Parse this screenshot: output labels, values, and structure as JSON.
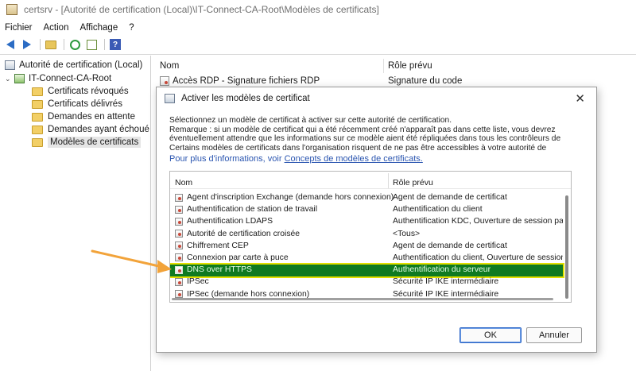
{
  "window": {
    "title": "certsrv - [Autorité de certification (Local)\\IT-Connect-CA-Root\\Modèles de certificats]"
  },
  "menu": [
    "Fichier",
    "Action",
    "Affichage",
    "?"
  ],
  "toolbar": {
    "icons": [
      "back-arrow-icon",
      "forward-arrow-icon",
      "folder-up-icon",
      "refresh-icon",
      "export-list-icon",
      "help-icon"
    ],
    "help_glyph": "?"
  },
  "tree": {
    "root": "Autorité de certification (Local)",
    "ca": "IT-Connect-CA-Root",
    "folders": [
      "Certificats révoqués",
      "Certificats délivrés",
      "Demandes en attente",
      "Demandes ayant échoué",
      "Modèles de certificats"
    ],
    "selected_index": 4
  },
  "list": {
    "col_name": "Nom",
    "col_role": "Rôle prévu",
    "rows": [
      {
        "name": "Accès RDP - Signature fichiers RDP",
        "role": "Signature du code"
      }
    ]
  },
  "dialog": {
    "title": "Activer les modèles de certificat",
    "close_glyph": "✕",
    "text_lines": [
      "Sélectionnez un modèle de certificat à activer sur cette autorité de certification.",
      "Remarque : si un modèle de certificat qui a été récemment créé n'apparaît pas dans cette liste, vous devrez",
      "éventuellement attendre que les informations sur ce modèle aient été répliquées dans tous les contrôleurs de",
      "Certains modèles de certificats dans l'organisation risquent de ne pas être accessibles à votre autorité de"
    ],
    "more_info_prefix": "Pour plus d'informations, voir ",
    "more_info_link": "Concepts de modèles de certificats.",
    "list": {
      "col_name": "Nom",
      "col_role": "Rôle prévu",
      "rows": [
        {
          "name": "Agent d'inscription Exchange (demande hors connexion)",
          "role": "Agent de demande de certificat"
        },
        {
          "name": "Authentification de station de travail",
          "role": "Authentification du client"
        },
        {
          "name": "Authentification LDAPS",
          "role": "Authentification KDC, Ouverture de session par c"
        },
        {
          "name": "Autorité de certification croisée",
          "role": "<Tous>"
        },
        {
          "name": "Chiffrement CEP",
          "role": "Agent de demande de certificat"
        },
        {
          "name": "Connexion par carte à puce",
          "role": "Authentification du client, Ouverture de session p"
        },
        {
          "name": "DNS over HTTPS",
          "role": "Authentification du serveur"
        },
        {
          "name": "IPSec",
          "role": "Sécurité IP IKE intermédiaire"
        },
        {
          "name": "IPSec (demande hors connexion)",
          "role": "Sécurité IP IKE intermédiaire"
        }
      ],
      "highlight_index": 6
    },
    "ok_label": "OK",
    "cancel_label": "Annuler"
  },
  "colors": {
    "highlight_bg": "#0f7a21",
    "highlight_outline": "#e3e000",
    "annotation_arrow": "#f2a33a",
    "link": "#2a55b0"
  }
}
